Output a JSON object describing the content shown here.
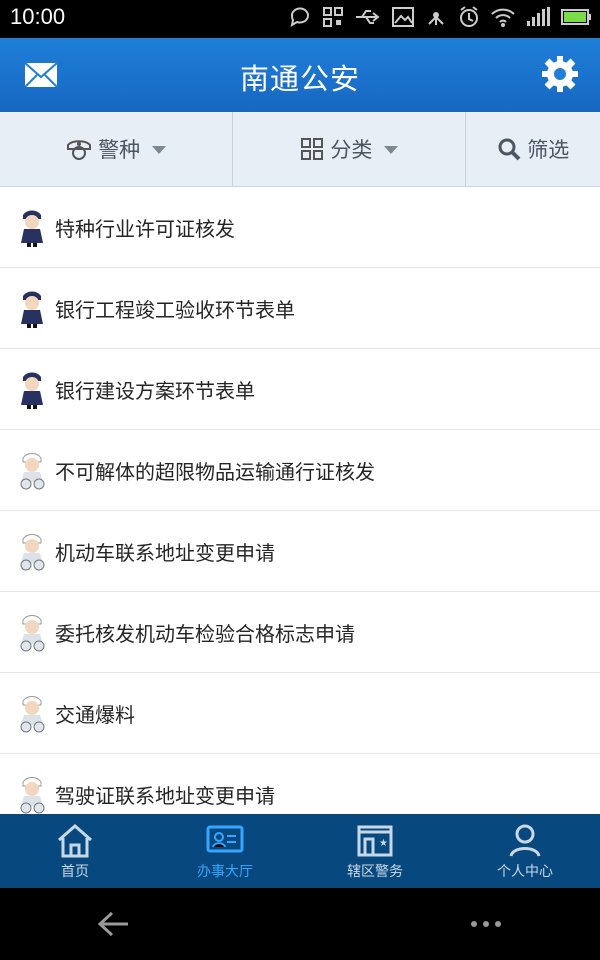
{
  "status_bar": {
    "time": "10:00",
    "icons": [
      "message-icon",
      "qr-icon",
      "usb-icon",
      "image-icon",
      "network-icon",
      "alarm-icon",
      "wifi-icon",
      "signal-icon",
      "battery-icon"
    ]
  },
  "header": {
    "title": "南通公安",
    "left_icon": "mail-icon",
    "right_icon": "gear-icon"
  },
  "filters": [
    {
      "label": "警种",
      "icon": "police-cap-icon",
      "has_dropdown": true
    },
    {
      "label": "分类",
      "icon": "grid-icon",
      "has_dropdown": true
    },
    {
      "label": "筛选",
      "icon": "search-icon",
      "has_dropdown": false
    }
  ],
  "services": [
    {
      "label": "特种行业许可证核发",
      "avatar": "police-officer-icon"
    },
    {
      "label": "银行工程竣工验收环节表单",
      "avatar": "police-officer-icon"
    },
    {
      "label": "银行建设方案环节表单",
      "avatar": "police-officer-icon"
    },
    {
      "label": "不可解体的超限物品运输通行证核发",
      "avatar": "traffic-police-icon"
    },
    {
      "label": "机动车联系地址变更申请",
      "avatar": "traffic-police-icon"
    },
    {
      "label": "委托核发机动车检验合格标志申请",
      "avatar": "traffic-police-icon"
    },
    {
      "label": "交通爆料",
      "avatar": "traffic-police-icon"
    },
    {
      "label": "驾驶证联系地址变更申请",
      "avatar": "traffic-police-icon"
    }
  ],
  "tabs": [
    {
      "label": "首页",
      "icon": "home-icon",
      "active": false
    },
    {
      "label": "办事大厅",
      "icon": "service-hall-icon",
      "active": true
    },
    {
      "label": "辖区警务",
      "icon": "police-station-icon",
      "active": false
    },
    {
      "label": "个人中心",
      "icon": "person-icon",
      "active": false
    }
  ],
  "nav": {
    "back_icon": "back-arrow-icon",
    "more_icon": "more-dots-icon"
  },
  "colors": {
    "app_blue": "#1f7fd9",
    "tab_bar": "#07497f",
    "active_tab": "#36a5ff"
  }
}
